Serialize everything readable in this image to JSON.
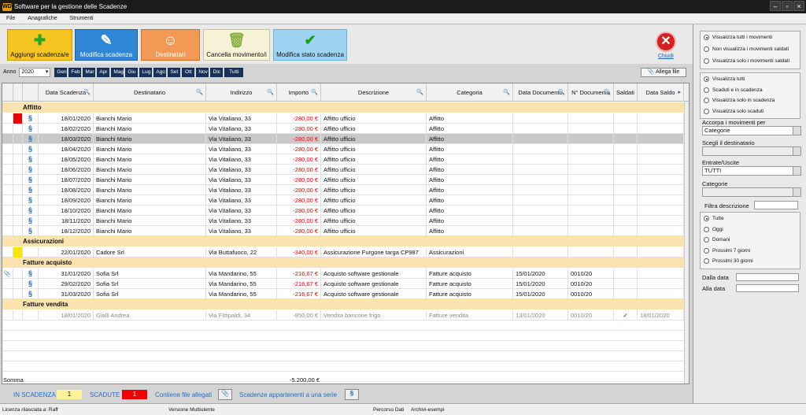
{
  "window": {
    "title": "Software per la gestione delle Scadenze",
    "app_icon": "WD"
  },
  "menu": [
    "File",
    "Anagrafiche",
    "Strumenti"
  ],
  "toolbar": {
    "aggiungi": "Aggiungi scadenza/e",
    "modifica": "Modifica scadenza",
    "destinatari": "Destinatari",
    "cancella": "Cancella movimento/i",
    "modifica_stato": "Modifica stato scadenza",
    "chiudi": "Chiudi"
  },
  "filter": {
    "anno_label": "Anno",
    "anno_value": "2020",
    "months": [
      "Gen",
      "Feb",
      "Mar",
      "Apr",
      "Mag",
      "Giu",
      "Lug",
      "Ago",
      "Set",
      "Ott",
      "Nov",
      "Dic",
      "Tutti"
    ],
    "allega": "Allega file"
  },
  "columns": [
    "Data Scadenza",
    "Destinatario",
    "Indirizzo",
    "Importo",
    "Descrizione",
    "Categoria",
    "Data Documento",
    "N° Documento",
    "Saldati",
    "Data Saldo"
  ],
  "groups": [
    {
      "name": "Affitto",
      "rows": [
        {
          "marker": "red",
          "date": "18/01/2020",
          "dest": "Bianchi Mario",
          "addr": "Via Vitaliano, 33",
          "amt": "-280,00 €",
          "desc": "Affitto ufficio",
          "cat": "Affitto",
          "ddoc": "",
          "ndoc": "",
          "saldati": "",
          "dsaldo": ""
        },
        {
          "date": "18/02/2020",
          "dest": "Bianchi Mario",
          "addr": "Via Vitaliano, 33",
          "amt": "-280,00 €",
          "desc": "Affitto ufficio",
          "cat": "Affitto",
          "ddoc": "",
          "ndoc": "",
          "saldati": "",
          "dsaldo": ""
        },
        {
          "selected": true,
          "date": "18/03/2020",
          "dest": "Bianchi Mario",
          "addr": "Via Vitaliano, 33",
          "amt": "-280,00 €",
          "desc": "Affitto ufficio",
          "cat": "Affitto",
          "ddoc": "",
          "ndoc": "",
          "saldati": "",
          "dsaldo": ""
        },
        {
          "date": "18/04/2020",
          "dest": "Bianchi Mario",
          "addr": "Via Vitaliano, 33",
          "amt": "-280,00 €",
          "desc": "Affitto ufficio",
          "cat": "Affitto",
          "ddoc": "",
          "ndoc": "",
          "saldati": "",
          "dsaldo": ""
        },
        {
          "date": "18/05/2020",
          "dest": "Bianchi Mario",
          "addr": "Via Vitaliano, 33",
          "amt": "-280,00 €",
          "desc": "Affitto ufficio",
          "cat": "Affitto",
          "ddoc": "",
          "ndoc": "",
          "saldati": "",
          "dsaldo": ""
        },
        {
          "date": "18/06/2020",
          "dest": "Bianchi Mario",
          "addr": "Via Vitaliano, 33",
          "amt": "-280,00 €",
          "desc": "Affitto ufficio",
          "cat": "Affitto",
          "ddoc": "",
          "ndoc": "",
          "saldati": "",
          "dsaldo": ""
        },
        {
          "date": "18/07/2020",
          "dest": "Bianchi Mario",
          "addr": "Via Vitaliano, 33",
          "amt": "-280,00 €",
          "desc": "Affitto ufficio",
          "cat": "Affitto",
          "ddoc": "",
          "ndoc": "",
          "saldati": "",
          "dsaldo": ""
        },
        {
          "date": "18/08/2020",
          "dest": "Bianchi Mario",
          "addr": "Via Vitaliano, 33",
          "amt": "-280,00 €",
          "desc": "Affitto ufficio",
          "cat": "Affitto",
          "ddoc": "",
          "ndoc": "",
          "saldati": "",
          "dsaldo": ""
        },
        {
          "date": "18/09/2020",
          "dest": "Bianchi Mario",
          "addr": "Via Vitaliano, 33",
          "amt": "-280,00 €",
          "desc": "Affitto ufficio",
          "cat": "Affitto",
          "ddoc": "",
          "ndoc": "",
          "saldati": "",
          "dsaldo": ""
        },
        {
          "date": "18/10/2020",
          "dest": "Bianchi Mario",
          "addr": "Via Vitaliano, 33",
          "amt": "-280,00 €",
          "desc": "Affitto ufficio",
          "cat": "Affitto",
          "ddoc": "",
          "ndoc": "",
          "saldati": "",
          "dsaldo": ""
        },
        {
          "date": "18/11/2020",
          "dest": "Bianchi Mario",
          "addr": "Via Vitaliano, 33",
          "amt": "-280,00 €",
          "desc": "Affitto ufficio",
          "cat": "Affitto",
          "ddoc": "",
          "ndoc": "",
          "saldati": "",
          "dsaldo": ""
        },
        {
          "date": "18/12/2020",
          "dest": "Bianchi Mario",
          "addr": "Via Vitaliano, 33",
          "amt": "-280,00 €",
          "desc": "Affitto ufficio",
          "cat": "Affitto",
          "ddoc": "",
          "ndoc": "",
          "saldati": "",
          "dsaldo": ""
        }
      ]
    },
    {
      "name": "Assicurazioni",
      "rows": [
        {
          "marker": "yellow",
          "norecur": true,
          "date": "22/01/2020",
          "dest": "Cadore Srl",
          "addr": "Via Buttafuoco, 22",
          "amt": "-340,00 €",
          "desc": "Assicurazione Furgone targa CP987",
          "cat": "Assicurazioni",
          "ddoc": "",
          "ndoc": "",
          "saldati": "",
          "dsaldo": ""
        }
      ]
    },
    {
      "name": "Fatture acquisto",
      "rows": [
        {
          "attach": true,
          "date": "31/01/2020",
          "dest": "Sofia Srl",
          "addr": "Via Mandarino, 55",
          "amt": "-216,67 €",
          "desc": "Acquisto software gestionale",
          "cat": "Fatture acquisto",
          "ddoc": "15/01/2020",
          "ndoc": "0010/20",
          "saldati": "",
          "dsaldo": ""
        },
        {
          "date": "29/02/2020",
          "dest": "Sofia Srl",
          "addr": "Via Mandarino, 55",
          "amt": "-216,67 €",
          "desc": "Acquisto software gestionale",
          "cat": "Fatture acquisto",
          "ddoc": "15/01/2020",
          "ndoc": "0010/20",
          "saldati": "",
          "dsaldo": ""
        },
        {
          "date": "31/03/2020",
          "dest": "Sofia Srl",
          "addr": "Via Mandarino, 55",
          "amt": "-216,67 €",
          "desc": "Acquisto software gestionale",
          "cat": "Fatture acquisto",
          "ddoc": "15/01/2020",
          "ndoc": "0010/20",
          "saldati": "",
          "dsaldo": ""
        }
      ]
    },
    {
      "name": "Fatture vendita",
      "rows": [
        {
          "paid": true,
          "norecur": true,
          "date": "18/01/2020",
          "dest": "Gialli Andrea",
          "addr": "Via Fittipaldi, 34",
          "amt": "-850,00 €",
          "desc": "Vendita bancone frigo",
          "cat": "Fatture vendita",
          "ddoc": "13/01/2020",
          "ndoc": "0010/20",
          "saldati": "✓",
          "dsaldo": "18/01/2020"
        }
      ]
    }
  ],
  "somma": {
    "label": "Somma",
    "value": "-5.200,00 €"
  },
  "status": {
    "in_scadenza_label": "IN SCADENZA",
    "in_scadenza": "1",
    "scadute_label": "SCADUTE",
    "scadute": "1",
    "allegati": "Contiene file allegati",
    "serie": "Scadenze appartenenti a una serie"
  },
  "panel": {
    "vis": [
      "Visualizza tutti i movimenti",
      "Non visualizza i movimenti saldati",
      "Visualizza solo i movimenti saldati"
    ],
    "vis2": [
      "Visualizza tutti",
      "Scaduti e in scadenza",
      "Visualizza solo in scadenza",
      "Visualizza solo scaduti"
    ],
    "accorpa_label": "Accorpa i movimenti per",
    "accorpa": "Categorie",
    "destinatario_label": "Scegli il destinatario",
    "destinatario": "",
    "entrate_label": "Entrate/Uscite",
    "entrate": "TUTTI",
    "categorie_label": "Categorie",
    "categorie": "",
    "filtra_label": "Filtra descrizione",
    "periodi": [
      "Tutte",
      "Oggi",
      "Domani",
      "Prossimi 7 giorni",
      "Prossimi 30 giorni"
    ],
    "dalla": "Dalla data",
    "alla": "Alla data"
  },
  "footer": {
    "licenza": "Licenza rilasciata a: Raff",
    "versione": "Versione Multiutente",
    "percorso": "Percorso Dati",
    "archivi": "Archivi-esempi"
  },
  "colors": {
    "accent_dark": "#17325a",
    "group_bg": "#fbe3b0",
    "expired": "#ee0000",
    "due": "#f7e600"
  }
}
